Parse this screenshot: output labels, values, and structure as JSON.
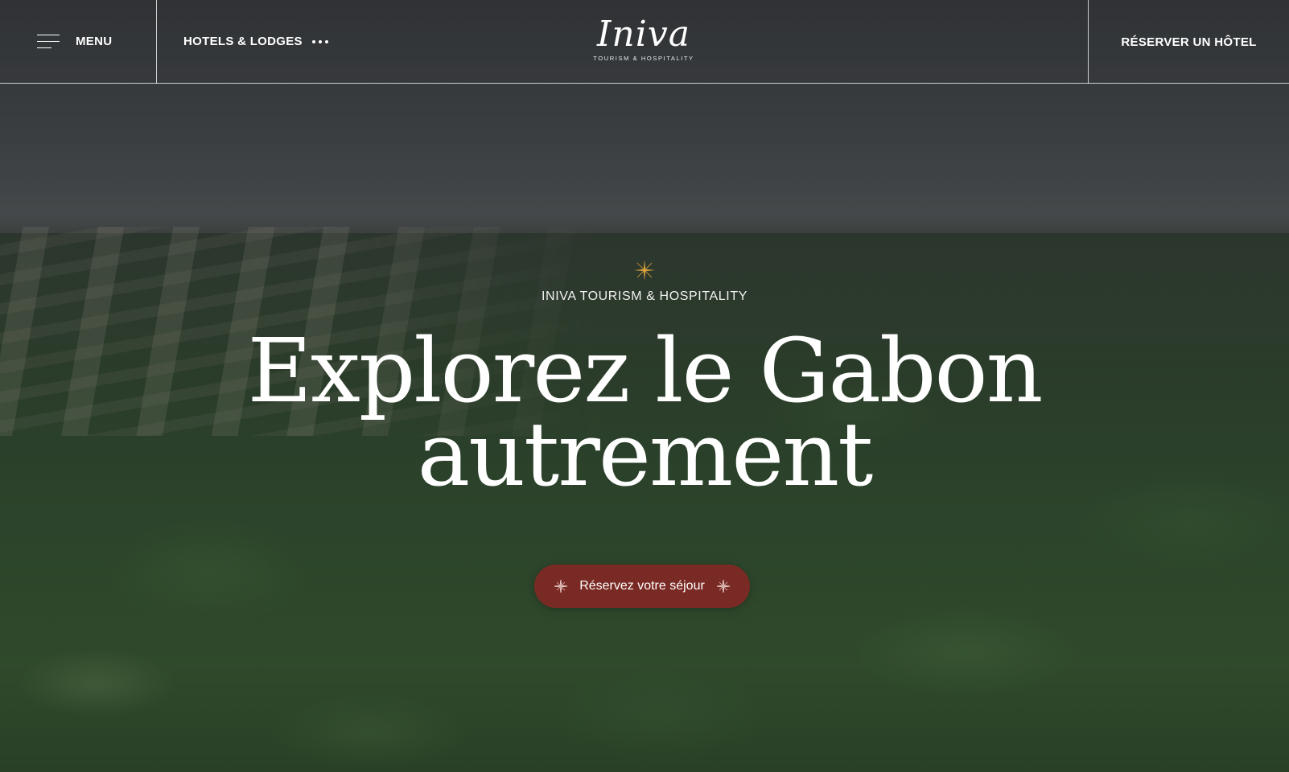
{
  "header": {
    "menu_label": "MENU",
    "hotels_label": "HOTELS & LODGES",
    "logo_word": "Iniva",
    "logo_tagline": "TOURISM & HOSPITALITY",
    "book_label": "RÉSERVER UN HÔTEL"
  },
  "hero": {
    "eyebrow": "INIVA TOURISM & HOSPITALITY",
    "headline_line1": "Explorez le Gabon",
    "headline_line2": "autrement",
    "cta_label": "Réservez votre séjour"
  },
  "icons": {
    "menu": "hamburger-icon",
    "more": "more-dots-icon",
    "accent": "sparkle-icon"
  },
  "colors": {
    "cta_background": "#7a2a24",
    "accent_gold": "#d9a23a",
    "text": "#ffffff"
  }
}
